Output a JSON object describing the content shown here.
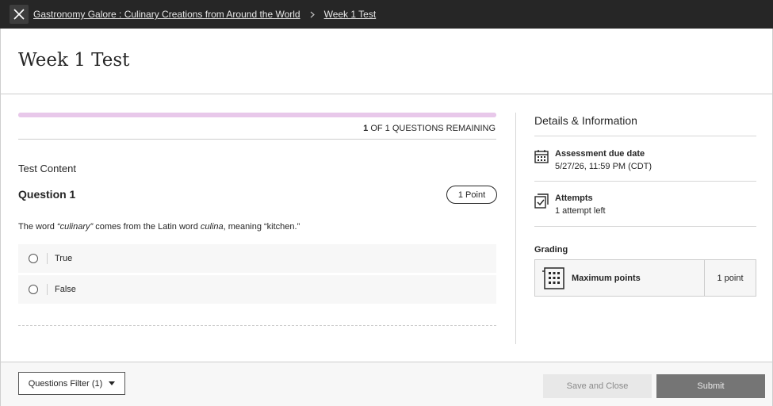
{
  "topbar": {
    "close_icon": "close-icon",
    "breadcrumb": [
      {
        "label": "Gastronomy Galore : Culinary Creations from Around the World"
      },
      {
        "label": "Week 1 Test"
      }
    ],
    "separator_icon": "chevron-right-icon"
  },
  "page": {
    "title": "Week 1 Test"
  },
  "progress": {
    "remaining_count": "1",
    "remaining_text": "OF 1 QUESTIONS REMAINING",
    "fill_percent": 100,
    "color": "#e8c8ea"
  },
  "content": {
    "section_label": "Test Content",
    "question": {
      "title": "Question 1",
      "points": "1 Point",
      "text_part1": "The word ",
      "text_italic1": "“culinary”",
      "text_part2": " comes from the Latin word ",
      "text_italic2": "culina",
      "text_part3": ", meaning “kitchen.”",
      "options": [
        {
          "label": "True"
        },
        {
          "label": "False"
        }
      ]
    }
  },
  "sidebar": {
    "title": "Details & Information",
    "due": {
      "icon": "calendar-icon",
      "label": "Assessment due date",
      "value": "5/27/26, 11:59 PM (CDT)"
    },
    "attempts": {
      "icon": "attempts-check-icon",
      "label": "Attempts",
      "value": "1 attempt left"
    },
    "grading": {
      "label": "Grading",
      "icon": "grade-calculator-icon",
      "title": "Maximum points",
      "value": "1 point"
    }
  },
  "footer": {
    "filter_label": "Questions Filter (1)",
    "save_label": "Save and Close",
    "submit_label": "Submit"
  },
  "colors": {
    "topbar": "#262626",
    "submit": "#757575",
    "save_disabled": "#e8e8e8"
  }
}
